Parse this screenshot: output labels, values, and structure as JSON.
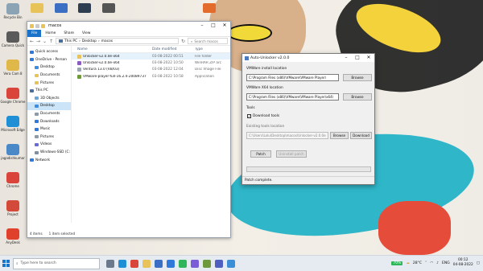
{
  "desktop": {
    "left_icons": [
      {
        "label": "Recycle Bin",
        "icon": "recycle-bin-icon",
        "color": "#8aa3b5"
      },
      {
        "label": "Camera Quick",
        "icon": "camera-icon",
        "color": "#5a5a5a"
      },
      {
        "label": "Vera Cam 8",
        "icon": "app-icon",
        "color": "#e0b84a"
      },
      {
        "label": "Google Chrome",
        "icon": "chrome-icon",
        "color": "#d9453b"
      },
      {
        "label": "Microsoft Edge",
        "icon": "edge-icon",
        "color": "#1f8fd6"
      },
      {
        "label": "jagadishkumar",
        "icon": "user-folder-icon",
        "color": "#4a89c8"
      },
      {
        "label": "Chrome",
        "icon": "chrome-icon",
        "color": "#d9453b"
      },
      {
        "label": "Project",
        "icon": "app-icon",
        "color": "#d44a3a"
      },
      {
        "label": "AnyDesk",
        "icon": "anydesk-icon",
        "color": "#e0412c"
      }
    ],
    "top_icons": [
      {
        "label": "",
        "icon": "folder-icon",
        "color": "#e8c35a"
      },
      {
        "label": "",
        "icon": "app-icon",
        "color": "#3a6fc4"
      },
      {
        "label": "",
        "icon": "monitor-icon",
        "color": "#2e3d4f"
      },
      {
        "label": "",
        "icon": "camera-icon",
        "color": "#555"
      },
      {
        "label": "",
        "icon": "app-icon",
        "color": "#e36c2c"
      }
    ]
  },
  "explorer": {
    "title": "macos",
    "ribbon_tabs": [
      "File",
      "Home",
      "Share",
      "View"
    ],
    "breadcrumb": [
      "This PC",
      "Desktop",
      "macos"
    ],
    "search_placeholder": "Search macos",
    "nav_items": [
      {
        "label": "Quick access",
        "icon": "star-icon",
        "color": "#2f7ad8",
        "indent": 0,
        "selected": false
      },
      {
        "label": "OneDrive - Person",
        "icon": "cloud-icon",
        "color": "#2f7ad8",
        "indent": 0,
        "selected": false
      },
      {
        "label": "Desktop",
        "icon": "folder-icon",
        "color": "#3b8ee0",
        "indent": 1,
        "selected": false
      },
      {
        "label": "Documents",
        "icon": "folder-icon",
        "color": "#e8c35a",
        "indent": 1,
        "selected": false
      },
      {
        "label": "Pictures",
        "icon": "folder-icon",
        "color": "#e8c35a",
        "indent": 1,
        "selected": false
      },
      {
        "label": "This PC",
        "icon": "pc-icon",
        "color": "#4a6f9c",
        "indent": 0,
        "selected": false
      },
      {
        "label": "3D Objects",
        "icon": "cube-icon",
        "color": "#6aa7d9",
        "indent": 1,
        "selected": false
      },
      {
        "label": "Desktop",
        "icon": "folder-icon",
        "color": "#3b8ee0",
        "indent": 1,
        "selected": true
      },
      {
        "label": "Documents",
        "icon": "folder-icon",
        "color": "#8c9aaa",
        "indent": 1,
        "selected": false
      },
      {
        "label": "Downloads",
        "icon": "download-icon",
        "color": "#2f7ad8",
        "indent": 1,
        "selected": false
      },
      {
        "label": "Music",
        "icon": "music-icon",
        "color": "#2f7ad8",
        "indent": 1,
        "selected": false
      },
      {
        "label": "Pictures",
        "icon": "folder-icon",
        "color": "#8c9aaa",
        "indent": 1,
        "selected": false
      },
      {
        "label": "Videos",
        "icon": "video-icon",
        "color": "#6b6bd6",
        "indent": 1,
        "selected": false
      },
      {
        "label": "Windows-SSD (C:",
        "icon": "drive-icon",
        "color": "#7e8fa3",
        "indent": 1,
        "selected": false
      },
      {
        "label": "Network",
        "icon": "network-icon",
        "color": "#2f7ad8",
        "indent": 0,
        "selected": false
      }
    ],
    "columns": [
      "Name",
      "Date modified",
      "Type"
    ],
    "files": [
      {
        "name": "Unlocker-v2.0.0e-x64",
        "date": "03-08-2022 00:51",
        "type": "File folder",
        "icon": "folder-icon",
        "color": "#e8c35a",
        "selected": true
      },
      {
        "name": "Unlocker-v2.0.0e-x64",
        "date": "03-08-2022 10:50",
        "type": "WinRAR ZIP arc",
        "icon": "zip-icon",
        "color": "#8a5cc2",
        "selected": false
      },
      {
        "name": "Ventura 13.0 (VB/03)",
        "date": "03-08-2022 12:04",
        "type": "Disc Image File",
        "icon": "disc-icon",
        "color": "#9aa5b1",
        "selected": false
      },
      {
        "name": "VMware-player-full-16.2.4-20089737",
        "date": "03-08-2022 10:58",
        "type": "Application",
        "icon": "vmware-icon",
        "color": "#6e9a3c",
        "selected": false
      }
    ],
    "status_items": "4 items",
    "status_selected": "1 item selected"
  },
  "unlocker": {
    "title": "Auto-Unlocker v2.0.0",
    "install_label": "VMWare install location",
    "install_value": "C:\\Program Files (x86)\\VMware\\VMware Player\\",
    "x64_label": "VMWare X64 location",
    "x64_value": "C:\\Program Files (x86)\\VMware\\VMware Player\\x64\\",
    "browse_label": "Browse",
    "tools_label": "Tools",
    "download_tools_label": "Download tools",
    "download_tools_checked": true,
    "existing_tools_label": "Existing tools location",
    "existing_tools_value": "C:\\Users\\Lolu\\Desktop\\macos\\Unlocker-v2.0.0e",
    "tools_browse_label": "Browse",
    "download_button_label": "Download",
    "patch_label": "Patch",
    "uninstall_label": "Uninstall patch",
    "progress": 0,
    "status": "Patch complete."
  },
  "taskbar": {
    "search_placeholder": "Type here to search",
    "apps": [
      {
        "icon": "task-view-icon",
        "color": "#6a7a8c"
      },
      {
        "icon": "edge-icon",
        "color": "#1f8fd6"
      },
      {
        "icon": "chrome-icon",
        "color": "#d9453b"
      },
      {
        "icon": "file-explorer-icon",
        "color": "#e8c35a"
      },
      {
        "icon": "store-icon",
        "color": "#3a6fc4"
      },
      {
        "icon": "mail-icon",
        "color": "#2f7ad8"
      },
      {
        "icon": "whatsapp-icon",
        "color": "#2fb55a"
      },
      {
        "icon": "app-icon",
        "color": "#7a5cd6"
      },
      {
        "icon": "vmware-icon",
        "color": "#6e9a3c"
      },
      {
        "icon": "teams-icon",
        "color": "#4e5fbf"
      },
      {
        "icon": "app-icon",
        "color": "#3a8fd6"
      }
    ],
    "battery": "70%",
    "weather": "28°C",
    "lang": "ENG",
    "time": "00:12",
    "date": "04-08-2022",
    "colors": {
      "accent": "#1a73c8",
      "progress_green": "#06b025"
    }
  }
}
